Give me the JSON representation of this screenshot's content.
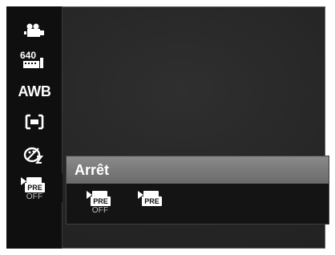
{
  "menu": {
    "items": [
      {
        "name": "movie-mode-icon",
        "type": "icon"
      },
      {
        "name": "resolution-icon",
        "type": "icon",
        "text": "640"
      },
      {
        "name": "awb-icon",
        "type": "text",
        "text": "AWB"
      },
      {
        "name": "metering-icon",
        "type": "icon"
      },
      {
        "name": "color-effect-icon",
        "type": "icon"
      },
      {
        "name": "pre-record-icon",
        "type": "icon",
        "badge": "PRE",
        "label": "OFF"
      }
    ]
  },
  "panel": {
    "title": "Arrêt",
    "options": [
      {
        "name": "pre-record-off",
        "badge": "PRE",
        "label": "OFF"
      },
      {
        "name": "pre-record-on",
        "badge": "PRE",
        "label": ""
      }
    ]
  }
}
